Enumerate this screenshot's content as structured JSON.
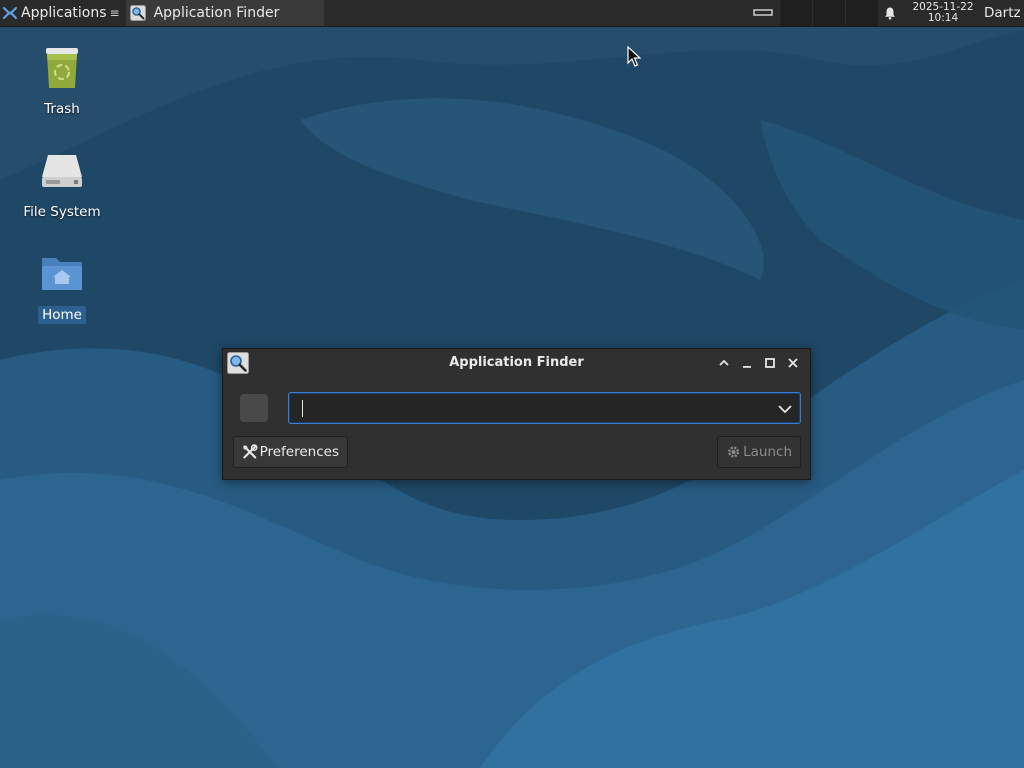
{
  "panel": {
    "apps_label": "Applications",
    "apps_tail": "≡",
    "task_title": "Application Finder",
    "clock_date": "2025-11-22",
    "clock_time": "10:14",
    "user": "Dartz"
  },
  "desktop": {
    "icons": [
      {
        "label": "Trash",
        "icon": "trash-icon"
      },
      {
        "label": "File System",
        "icon": "drive-icon"
      },
      {
        "label": "Home",
        "icon": "home-folder-icon"
      }
    ]
  },
  "dialog": {
    "title": "Application Finder",
    "search_value": "",
    "preferences_label": "Preferences",
    "launch_label": "Launch"
  },
  "colors": {
    "panel": "#2a2a2a",
    "dialog_bg": "#303030",
    "accent": "#3c7bd4",
    "wallpaper_dark": "#1f4a68",
    "wallpaper_light": "#2e6a94"
  }
}
